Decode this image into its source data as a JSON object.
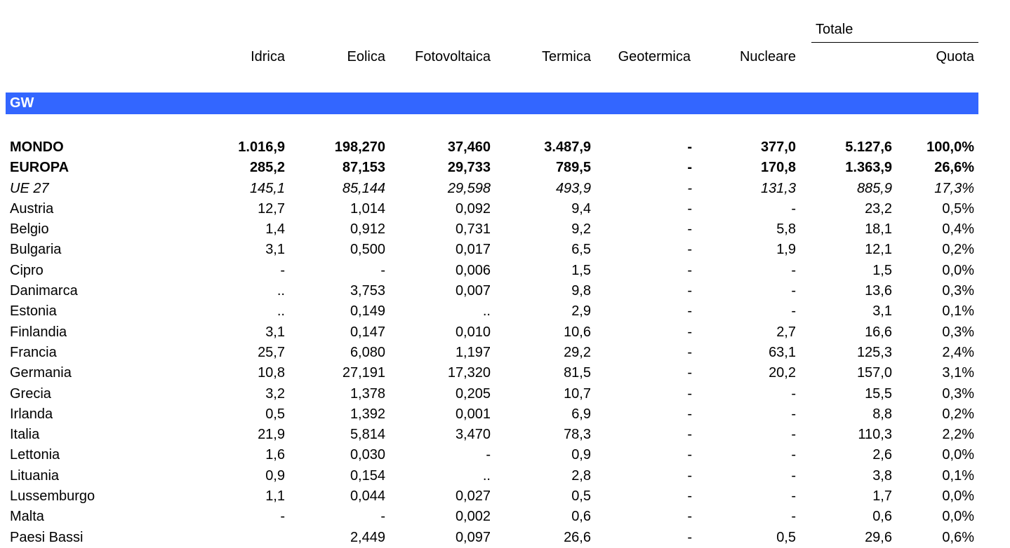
{
  "header": {
    "totale": "Totale",
    "columns": [
      "Idrica",
      "Eolica",
      "Fotovoltaica",
      "Termica",
      "Geotermica",
      "Nucleare",
      "Quota"
    ]
  },
  "section": {
    "label": "GW"
  },
  "rows": [
    {
      "name": "MONDO",
      "style": "bold",
      "values": [
        "1.016,9",
        "198,270",
        "37,460",
        "3.487,9",
        "-",
        "377,0",
        "5.127,6",
        "100,0%"
      ]
    },
    {
      "name": "EUROPA",
      "style": "bold",
      "values": [
        "285,2",
        "87,153",
        "29,733",
        "789,5",
        "-",
        "170,8",
        "1.363,9",
        "26,6%"
      ]
    },
    {
      "name": "UE 27",
      "style": "italic",
      "values": [
        "145,1",
        "85,144",
        "29,598",
        "493,9",
        "-",
        "131,3",
        "885,9",
        "17,3%"
      ]
    },
    {
      "name": "Austria",
      "style": "",
      "values": [
        "12,7",
        "1,014",
        "0,092",
        "9,4",
        "-",
        "-",
        "23,2",
        "0,5%"
      ]
    },
    {
      "name": "Belgio",
      "style": "",
      "values": [
        "1,4",
        "0,912",
        "0,731",
        "9,2",
        "-",
        "5,8",
        "18,1",
        "0,4%"
      ]
    },
    {
      "name": "Bulgaria",
      "style": "",
      "values": [
        "3,1",
        "0,500",
        "0,017",
        "6,5",
        "-",
        "1,9",
        "12,1",
        "0,2%"
      ]
    },
    {
      "name": "Cipro",
      "style": "",
      "values": [
        "-",
        "-",
        "0,006",
        "1,5",
        "-",
        "-",
        "1,5",
        "0,0%"
      ]
    },
    {
      "name": "Danimarca",
      "style": "",
      "values": [
        "..",
        "3,753",
        "0,007",
        "9,8",
        "-",
        "-",
        "13,6",
        "0,3%"
      ]
    },
    {
      "name": "Estonia",
      "style": "",
      "values": [
        "..",
        "0,149",
        "..",
        "2,9",
        "-",
        "-",
        "3,1",
        "0,1%"
      ]
    },
    {
      "name": "Finlandia",
      "style": "",
      "values": [
        "3,1",
        "0,147",
        "0,010",
        "10,6",
        "-",
        "2,7",
        "16,6",
        "0,3%"
      ]
    },
    {
      "name": "Francia",
      "style": "",
      "values": [
        "25,7",
        "6,080",
        "1,197",
        "29,2",
        "-",
        "63,1",
        "125,3",
        "2,4%"
      ]
    },
    {
      "name": "Germania",
      "style": "",
      "values": [
        "10,8",
        "27,191",
        "17,320",
        "81,5",
        "-",
        "20,2",
        "157,0",
        "3,1%"
      ]
    },
    {
      "name": "Grecia",
      "style": "",
      "values": [
        "3,2",
        "1,378",
        "0,205",
        "10,7",
        "-",
        "-",
        "15,5",
        "0,3%"
      ]
    },
    {
      "name": "Irlanda",
      "style": "",
      "values": [
        "0,5",
        "1,392",
        "0,001",
        "6,9",
        "-",
        "-",
        "8,8",
        "0,2%"
      ]
    },
    {
      "name": "Italia",
      "style": "",
      "values": [
        "21,9",
        "5,814",
        "3,470",
        "78,3",
        "-",
        "-",
        "110,3",
        "2,2%"
      ]
    },
    {
      "name": "Lettonia",
      "style": "",
      "values": [
        "1,6",
        "0,030",
        "-",
        "0,9",
        "-",
        "-",
        "2,6",
        "0,0%"
      ]
    },
    {
      "name": "Lituania",
      "style": "",
      "values": [
        "0,9",
        "0,154",
        "..",
        "2,8",
        "-",
        "-",
        "3,8",
        "0,1%"
      ]
    },
    {
      "name": "Lussemburgo",
      "style": "",
      "values": [
        "1,1",
        "0,044",
        "0,027",
        "0,5",
        "-",
        "-",
        "1,7",
        "0,0%"
      ]
    },
    {
      "name": "Malta",
      "style": "",
      "values": [
        "-",
        "-",
        "0,002",
        "0,6",
        "-",
        "-",
        "0,6",
        "0,0%"
      ]
    },
    {
      "name": "Paesi Bassi",
      "style": "",
      "values": [
        "",
        "2,449",
        "0,097",
        "26,6",
        "-",
        "0,5",
        "29,6",
        "0,6%"
      ]
    }
  ],
  "colors": {
    "band": "#3366ff",
    "band_text": "#ffffff"
  }
}
